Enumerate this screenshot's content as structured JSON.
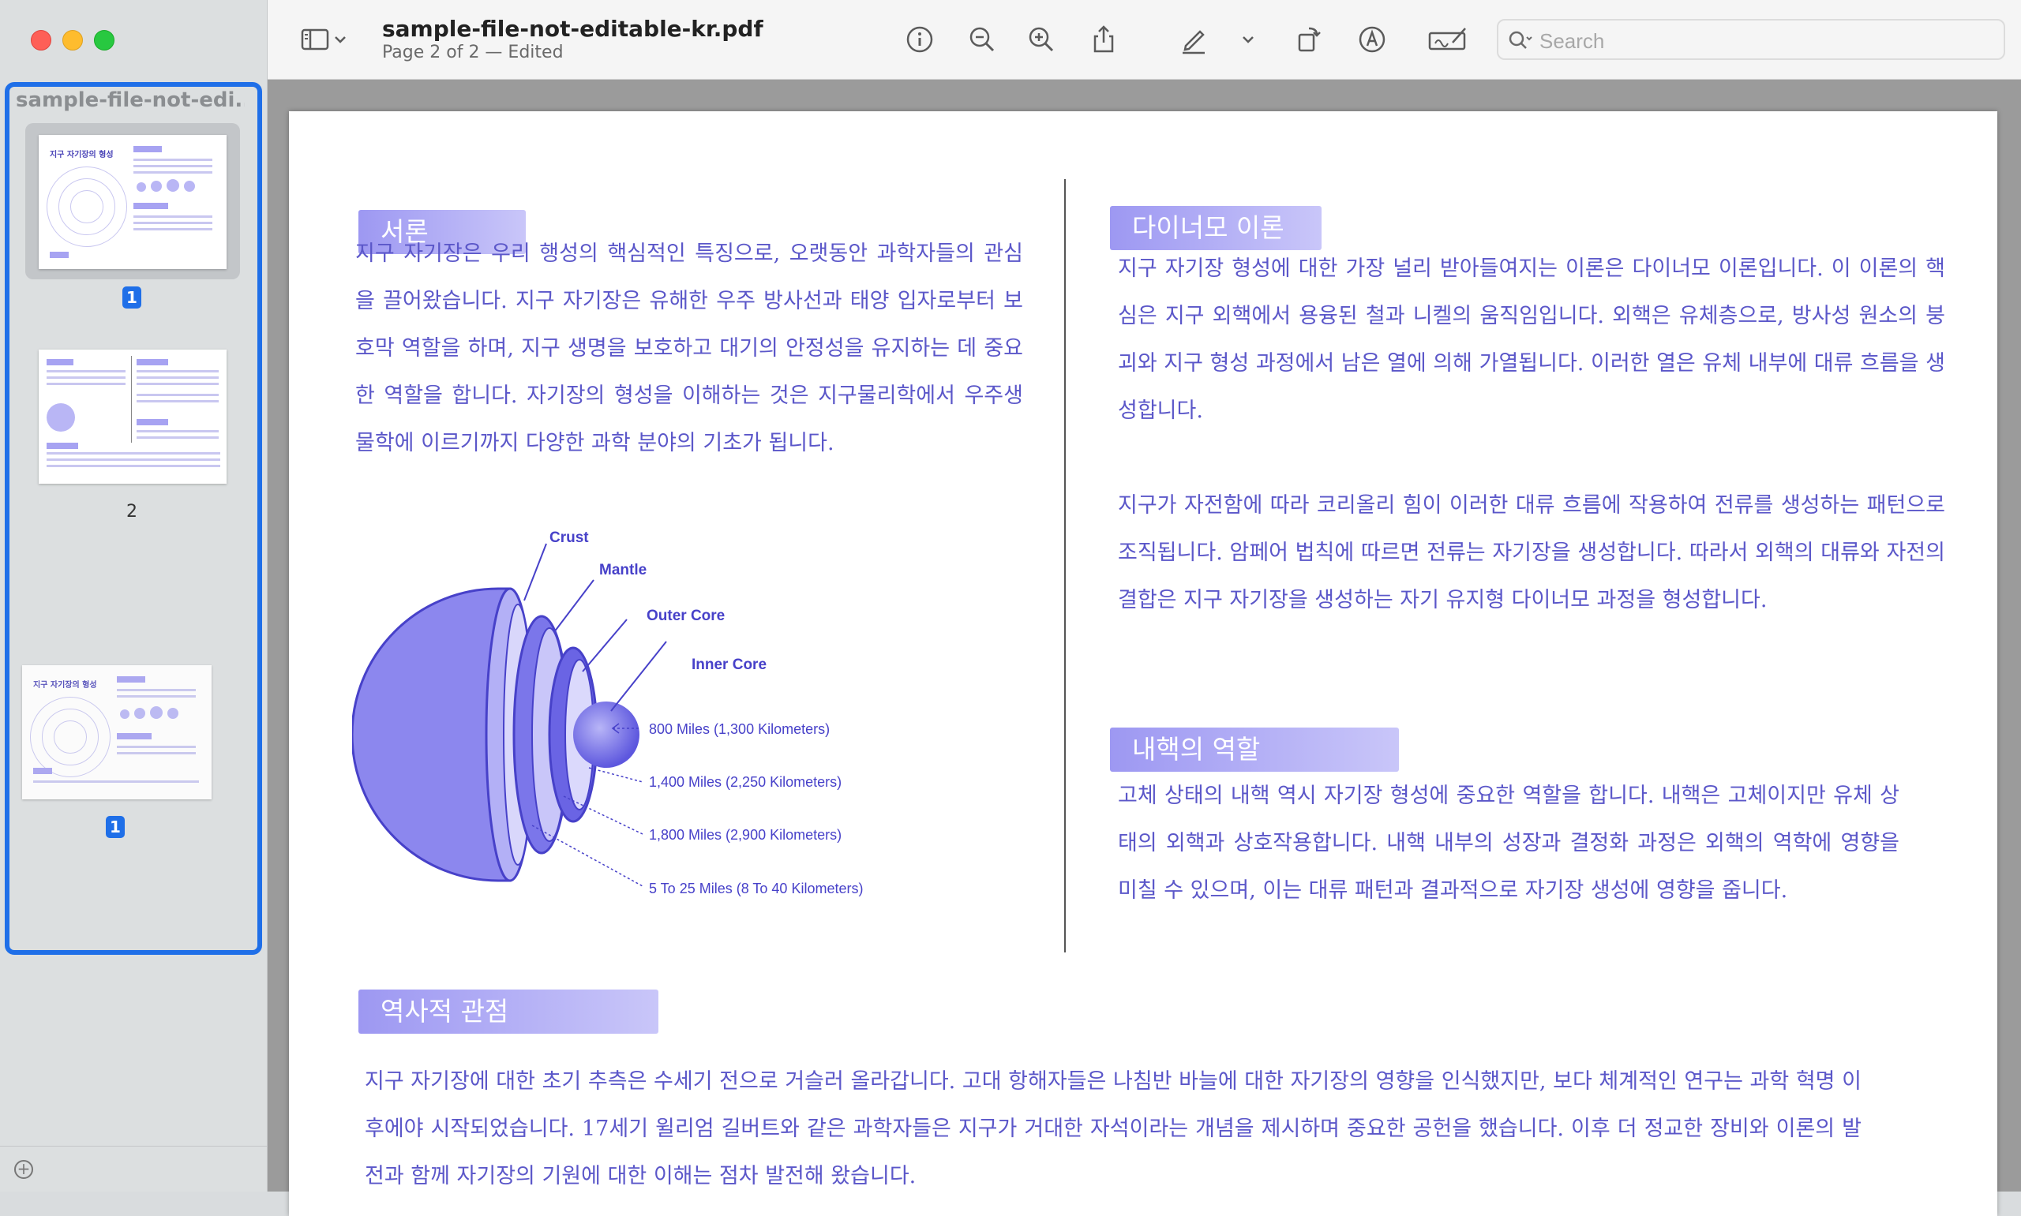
{
  "window": {
    "doc_title": "sample-file-not-editable-kr.pdf",
    "doc_subtitle": "Page 2 of 2 — Edited"
  },
  "sidebar": {
    "filename": "sample-file-not-edi...",
    "thumbnails": [
      {
        "badge": "1",
        "title": "지구 자기장의 형성",
        "selected": true
      },
      {
        "label": "2",
        "selected": false
      },
      {
        "badge": "1",
        "title": "지구 자기장의 형성",
        "selected": false
      }
    ]
  },
  "toolbar": {
    "search_placeholder": "Search",
    "icons": [
      "sidebar-toggle-icon",
      "chevron-down-icon",
      "info-icon",
      "zoom-out-icon",
      "zoom-in-icon",
      "share-icon",
      "markup-pen-icon",
      "chevron-down-icon",
      "rotate-icon",
      "annotate-icon",
      "signature-icon",
      "search-icon"
    ]
  },
  "page": {
    "left": {
      "intro_heading": "서론",
      "intro_text": "지구 자기장은 우리 행성의 핵심적인 특징으로, 오랫동안 과학자들의 관심을 끌어왔습니다. 지구 자기장은 유해한 우주 방사선과 태양 입자로부터 보호막 역할을 하며, 지구 생명을 보호하고 대기의 안정성을 유지하는 데 중요한 역할을 합니다. 자기장의 형성을 이해하는 것은 지구물리학에서 우주생물학에 이르기까지 다양한 과학 분야의 기초가 됩니다.",
      "diagram": {
        "crust": "Crust",
        "mantle": "Mantle",
        "outer_core": "Outer Core",
        "inner_core": "Inner Core",
        "dim1": "800 Miles (1,300 Kilometers)",
        "dim2": "1,400 Miles (2,250 Kilometers)",
        "dim3": "1,800 Miles (2,900 Kilometers)",
        "dim4": "5 To 25 Miles (8 To 40 Kilometers)"
      }
    },
    "right": {
      "dynamo_heading": "다이너모 이론",
      "dynamo_p1": "지구 자기장 형성에 대한 가장 널리 받아들여지는 이론은 다이너모 이론입니다. 이 이론의 핵심은 지구 외핵에서 용융된 철과 니켈의 움직임입니다. 외핵은 유체층으로, 방사성 원소의 붕괴와 지구 형성 과정에서 남은 열에 의해 가열됩니다. 이러한 열은 유체 내부에 대류 흐름을 생성합니다.",
      "dynamo_p2": "지구가 자전함에 따라 코리올리 힘이 이러한 대류 흐름에 작용하여 전류를 생성하는 패턴으로 조직됩니다. 암페어 법칙에 따르면 전류는 자기장을 생성합니다. 따라서 외핵의 대류와 자전의 결합은 지구 자기장을 생성하는 자기 유지형 다이너모 과정을 형성합니다.",
      "inner_heading": "내핵의 역할",
      "inner_text": "고체 상태의 내핵 역시 자기장 형성에 중요한 역할을 합니다. 내핵은 고체이지만 유체 상태의 외핵과 상호작용합니다. 내핵 내부의 성장과 결정화 과정은 외핵의 역학에 영향을 미칠 수 있으며, 이는 대류 패턴과 결과적으로 자기장 생성에 영향을 줍니다."
    },
    "bottom": {
      "history_heading": "역사적 관점",
      "history_text": "지구 자기장에 대한 초기 추측은 수세기 전으로 거슬러 올라갑니다. 고대 항해자들은 나침반 바늘에 대한 자기장의 영향을 인식했지만, 보다 체계적인 연구는 과학 혁명 이후에야 시작되었습니다. 17세기 윌리엄 길버트와 같은 과학자들은 지구가 거대한 자석이라는 개념을 제시하며 중요한 공헌을 했습니다. 이후 더 정교한 장비와 이론의 발전과 함께 자기장의 기원에 대한 이해는 점차 발전해 왔습니다."
    }
  }
}
